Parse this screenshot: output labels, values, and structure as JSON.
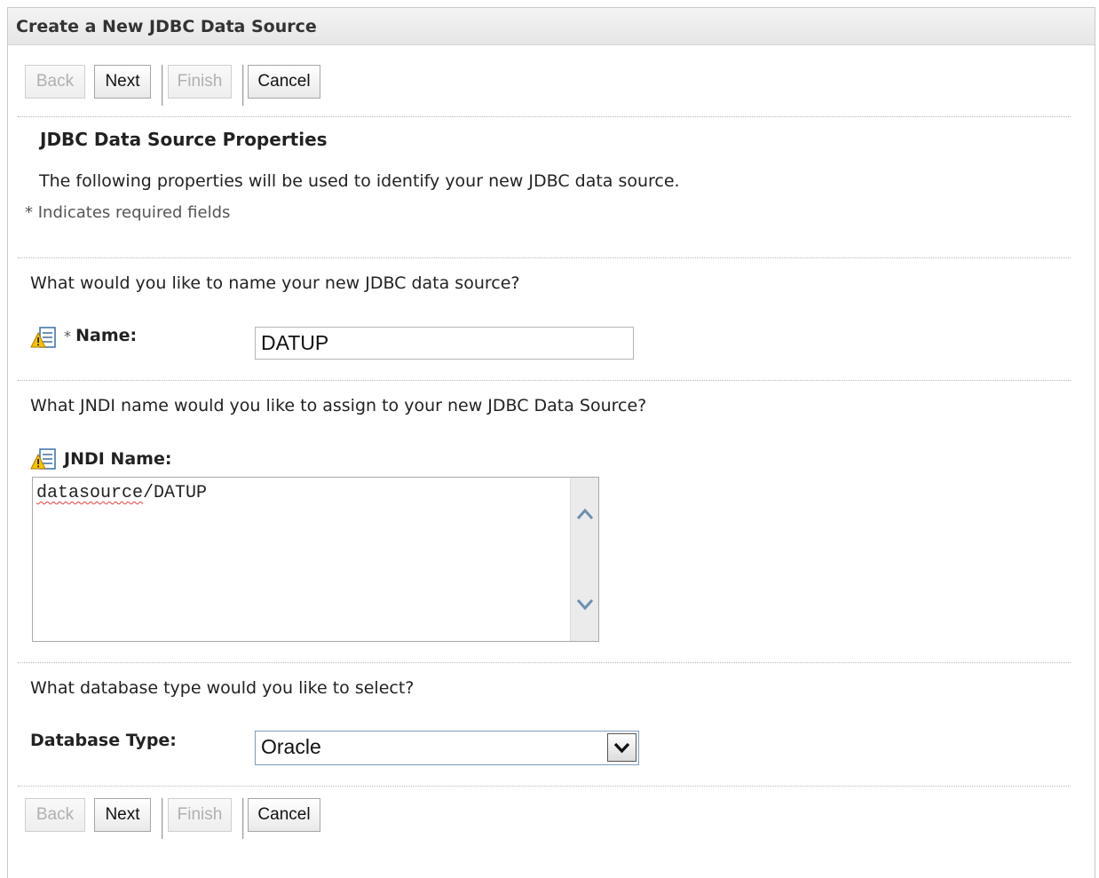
{
  "panel": {
    "title": "Create a New JDBC Data Source"
  },
  "buttons": {
    "back": "Back",
    "next": "Next",
    "finish": "Finish",
    "cancel": "Cancel"
  },
  "section": {
    "title": "JDBC Data Source Properties",
    "description": "The following properties will be used to identify your new JDBC data source.",
    "required_hint": "* Indicates required fields"
  },
  "name_field": {
    "question": "What would you like to name your new JDBC data source?",
    "required_marker": "*",
    "label": "Name:",
    "value": "DATUP",
    "icon": "config-warning-icon"
  },
  "jndi_field": {
    "question": "What JNDI name would you like to assign to your new JDBC Data Source?",
    "label": "JNDI Name:",
    "value_prefix": "datasource",
    "value_suffix": "/DATUP",
    "icon": "config-warning-icon"
  },
  "database_type": {
    "question": "What database type would you like to select?",
    "label": "Database Type:",
    "selected": "Oracle"
  },
  "colors": {
    "title_bar": "#e9e9e9",
    "spell_error": "#e04040",
    "disabled_text": "#b0b0b0"
  }
}
